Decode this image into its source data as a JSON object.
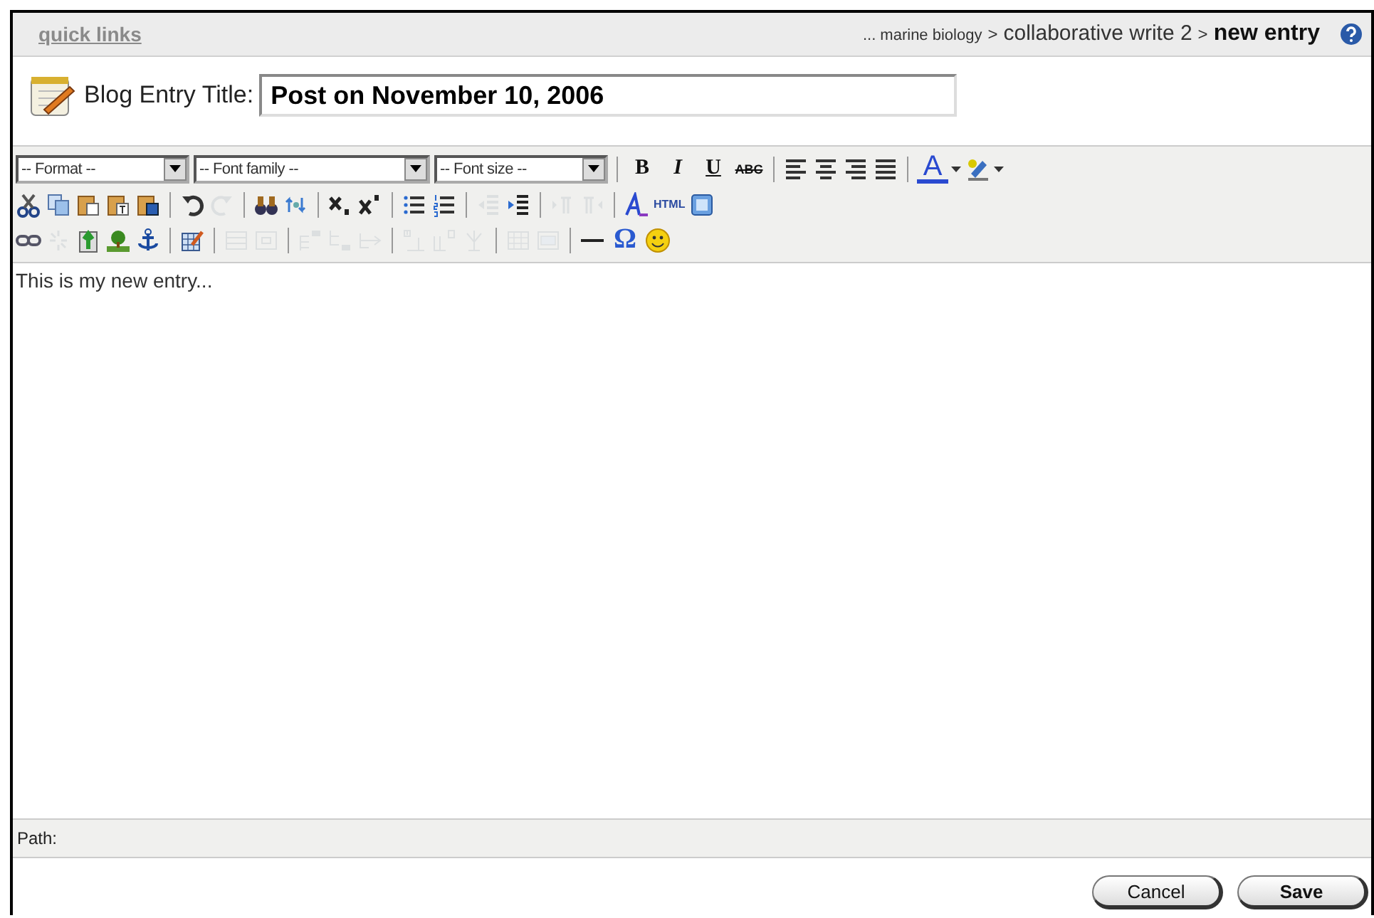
{
  "header": {
    "quick_links": "quick links",
    "breadcrumb": [
      {
        "label": "... marine biology",
        "current": false
      },
      {
        "label": ">",
        "kind": "sep"
      },
      {
        "label": "collaborative write 2",
        "current": false
      },
      {
        "label": ">",
        "kind": "sep"
      },
      {
        "label": "new entry",
        "current": true
      }
    ]
  },
  "title_field": {
    "label": "Blog Entry Title:",
    "value": "Post on November 10, 2006"
  },
  "toolbar": [
    [
      {
        "kind": "select",
        "label": "-- Format --"
      },
      {
        "kind": "select",
        "label": "-- Font family --"
      },
      {
        "kind": "select",
        "label": "-- Font size --"
      },
      {
        "kind": "sep"
      },
      {
        "kind": "text",
        "label": "B"
      },
      {
        "kind": "text",
        "label": "I"
      },
      {
        "kind": "text",
        "label": "U"
      },
      {
        "kind": "text",
        "label": "ABC"
      },
      {
        "kind": "sep"
      },
      {
        "kind": "icon",
        "disabled": false
      },
      {
        "kind": "icon",
        "disabled": false
      },
      {
        "kind": "icon",
        "disabled": false
      },
      {
        "kind": "icon",
        "disabled": false
      },
      {
        "kind": "sep"
      },
      {
        "kind": "text",
        "label": "A"
      },
      {
        "kind": "icon",
        "disabled": false
      }
    ],
    [
      {
        "kind": "icon",
        "disabled": false
      },
      {
        "kind": "icon",
        "disabled": false
      },
      {
        "kind": "icon",
        "disabled": false
      },
      {
        "kind": "icon",
        "disabled": false
      },
      {
        "kind": "icon",
        "disabled": false
      },
      {
        "kind": "sep"
      },
      {
        "kind": "icon",
        "disabled": false
      },
      {
        "kind": "icon",
        "disabled": true
      },
      {
        "kind": "sep"
      },
      {
        "kind": "icon",
        "disabled": false
      },
      {
        "kind": "icon",
        "disabled": false
      },
      {
        "kind": "sep"
      },
      {
        "kind": "icon",
        "disabled": false
      },
      {
        "kind": "icon",
        "disabled": false
      },
      {
        "kind": "sep"
      },
      {
        "kind": "icon",
        "disabled": false
      },
      {
        "kind": "icon",
        "disabled": false
      },
      {
        "kind": "sep"
      },
      {
        "kind": "icon",
        "disabled": true
      },
      {
        "kind": "icon",
        "disabled": false
      },
      {
        "kind": "sep"
      },
      {
        "kind": "icon",
        "disabled": true
      },
      {
        "kind": "icon",
        "disabled": true
      },
      {
        "kind": "sep"
      },
      {
        "kind": "icon",
        "disabled": false
      },
      {
        "kind": "text",
        "label": "HTML"
      },
      {
        "kind": "icon",
        "disabled": false
      }
    ],
    [
      {
        "kind": "icon",
        "disabled": false
      },
      {
        "kind": "icon",
        "disabled": true
      },
      {
        "kind": "icon",
        "disabled": false
      },
      {
        "kind": "icon",
        "disabled": false
      },
      {
        "kind": "icon",
        "disabled": false
      },
      {
        "kind": "sep"
      },
      {
        "kind": "icon",
        "disabled": false
      },
      {
        "kind": "sep"
      },
      {
        "kind": "icon",
        "disabled": true
      },
      {
        "kind": "icon",
        "disabled": true
      },
      {
        "kind": "sep"
      },
      {
        "kind": "icon",
        "disabled": true
      },
      {
        "kind": "icon",
        "disabled": true
      },
      {
        "kind": "icon",
        "disabled": true
      },
      {
        "kind": "sep"
      },
      {
        "kind": "icon",
        "disabled": true
      },
      {
        "kind": "icon",
        "disabled": true
      },
      {
        "kind": "icon",
        "disabled": true
      },
      {
        "kind": "sep"
      },
      {
        "kind": "icon",
        "disabled": true
      },
      {
        "kind": "icon",
        "disabled": true
      },
      {
        "kind": "sep"
      },
      {
        "kind": "icon",
        "disabled": false
      },
      {
        "kind": "text",
        "label": "Ω"
      },
      {
        "kind": "icon",
        "disabled": false
      }
    ]
  ],
  "content": "This is my new entry...",
  "path_bar": {
    "label": "Path:"
  },
  "buttons": [
    {
      "label": "Cancel",
      "primary": false
    },
    {
      "label": "Save",
      "primary": true
    }
  ]
}
